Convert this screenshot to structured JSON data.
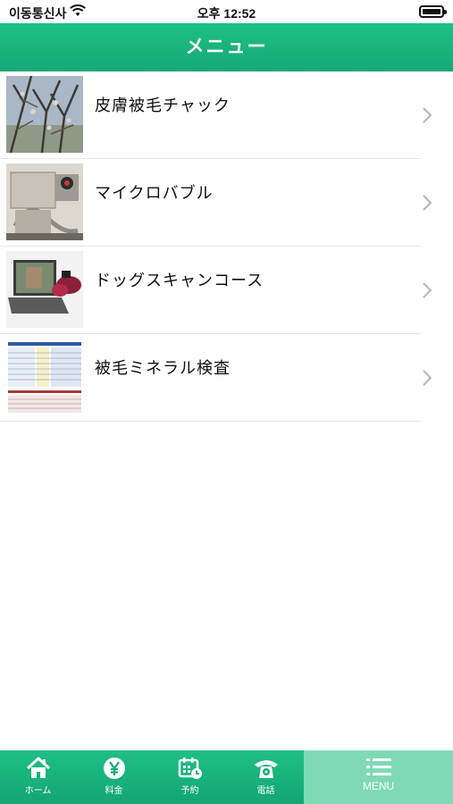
{
  "status_bar": {
    "carrier": "이동통신사",
    "time": "오후 12:52"
  },
  "header": {
    "title": "メニュー"
  },
  "menu": {
    "items": [
      {
        "label": "皮膚被毛チャック",
        "image": "tree-branches-photo"
      },
      {
        "label": "マイクロバブル",
        "image": "microbubble-machine-photo"
      },
      {
        "label": "ドッグスキャンコース",
        "image": "laptop-scanner-photo"
      },
      {
        "label": "被毛ミネラル検査",
        "image": "mineral-report-photo"
      }
    ]
  },
  "tabs": [
    {
      "label": "ホーム",
      "icon": "home-icon"
    },
    {
      "label": "料金",
      "icon": "yen-icon"
    },
    {
      "label": "予約",
      "icon": "calendar-icon"
    },
    {
      "label": "電話",
      "icon": "phone-icon"
    },
    {
      "label": "MENU",
      "icon": "menu-list-icon"
    }
  ],
  "colors": {
    "primary": "#1ab07d",
    "active_tab": "#7fd9b6"
  }
}
